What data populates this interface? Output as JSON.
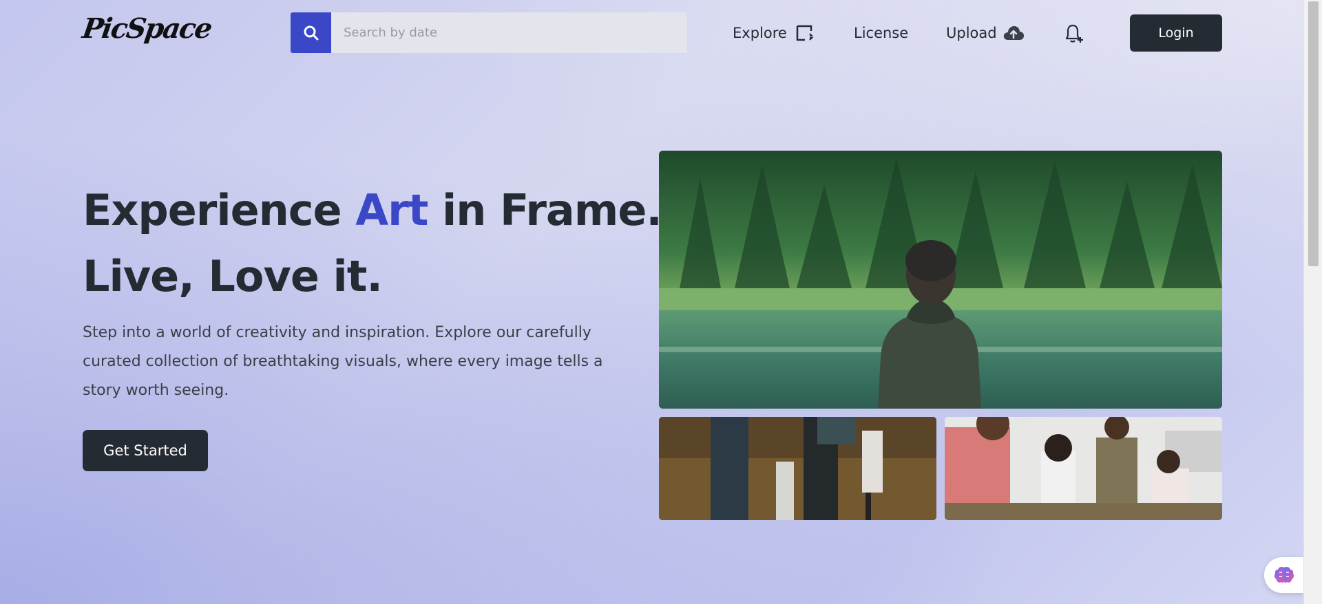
{
  "brand": {
    "logo_text": "PicSpace"
  },
  "search": {
    "placeholder": "Search by date",
    "value": ""
  },
  "nav": {
    "explore_label": "Explore",
    "license_label": "License",
    "upload_label": "Upload",
    "login_label": "Login"
  },
  "hero": {
    "headline_part1": "Experience ",
    "headline_accent": "Art",
    "headline_part2": " in Frame.",
    "headline_line2": "Live, Love it.",
    "subtext": "Step into a world of creativity and inspiration. Explore our carefully curated collection of breathtaking visuals, where every image tells a story worth seeing.",
    "cta_label": "Get Started"
  },
  "icons": {
    "search": "search-icon",
    "explore": "explore-icon",
    "upload": "cloud-upload-icon",
    "notifications": "bell-plus-icon",
    "assistant": "brain-icon"
  },
  "colors": {
    "accent": "#3a48c8",
    "dark": "#252b33",
    "search_bg": "#e4e4ec"
  }
}
